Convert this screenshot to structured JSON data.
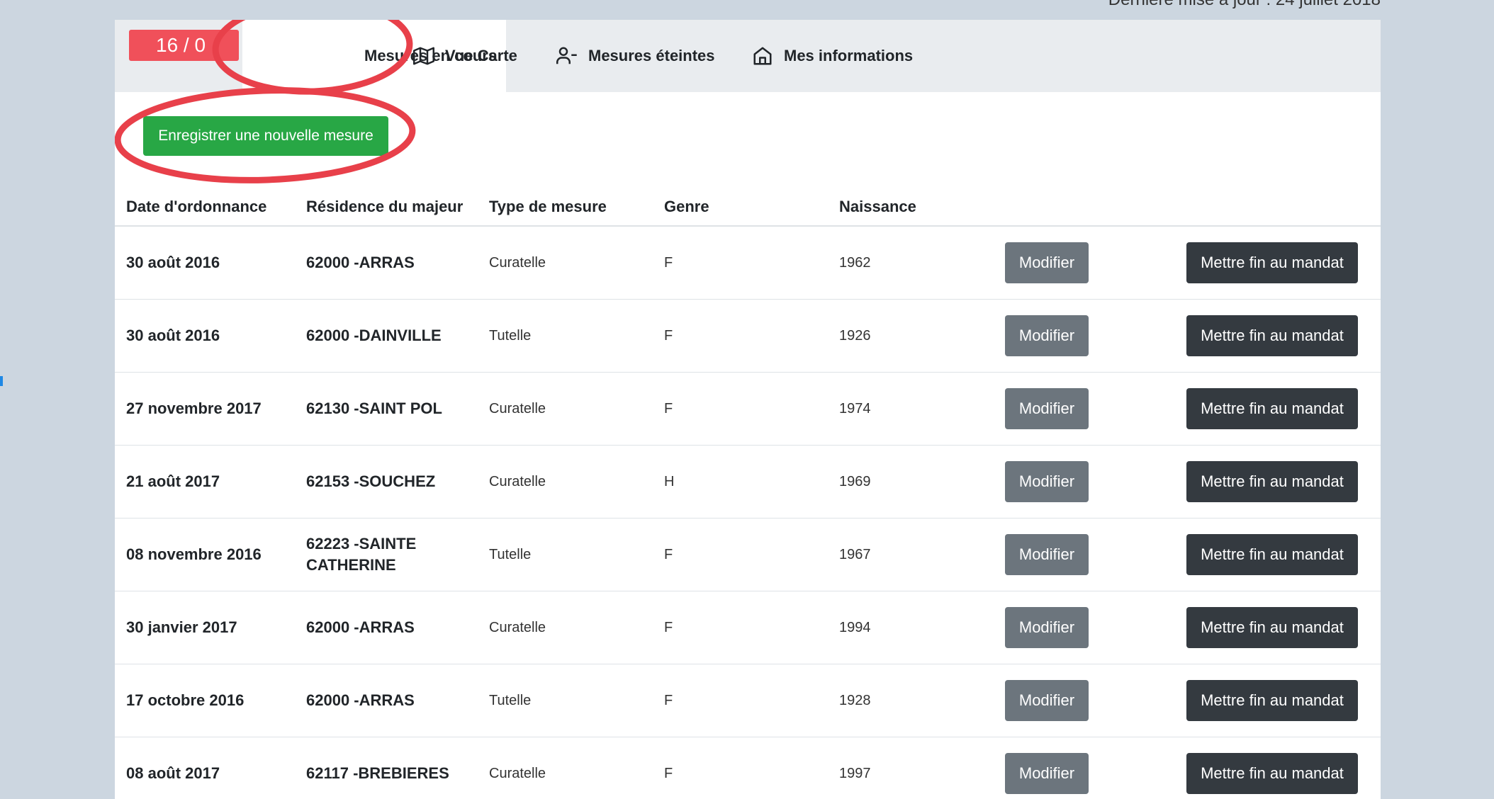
{
  "header": {
    "last_update": "Dernière mise à jour : 24 juillet 2018"
  },
  "counter": "16 / 0",
  "tabs": [
    {
      "label": "Mesures en cours",
      "icon": "none",
      "active": true
    },
    {
      "label": "Vue Carte",
      "icon": "map-icon"
    },
    {
      "label": "Mesures éteintes",
      "icon": "user-minus-icon"
    },
    {
      "label": "Mes informations",
      "icon": "home-icon"
    }
  ],
  "new_measure_button": "Enregistrer une nouvelle mesure",
  "table": {
    "columns": [
      "Date d'ordonnance",
      "Résidence du majeur",
      "Type de mesure",
      "Genre",
      "Naissance"
    ],
    "modify_label": "Modifier",
    "end_label": "Mettre fin au mandat",
    "rows": [
      {
        "date": "30 août 2016",
        "residence": "62000 -ARRAS",
        "type": "Curatelle",
        "genre": "F",
        "naissance": "1962"
      },
      {
        "date": "30 août 2016",
        "residence": "62000 -DAINVILLE",
        "type": "Tutelle",
        "genre": "F",
        "naissance": "1926"
      },
      {
        "date": "27 novembre 2017",
        "residence": "62130 -SAINT POL",
        "type": "Curatelle",
        "genre": "F",
        "naissance": "1974"
      },
      {
        "date": "21 août 2017",
        "residence": "62153 -SOUCHEZ",
        "type": "Curatelle",
        "genre": "H",
        "naissance": "1969"
      },
      {
        "date": "08 novembre 2016",
        "residence": "62223 -SAINTE CATHERINE",
        "type": "Tutelle",
        "genre": "F",
        "naissance": "1967"
      },
      {
        "date": "30 janvier 2017",
        "residence": "62000 -ARRAS",
        "type": "Curatelle",
        "genre": "F",
        "naissance": "1994"
      },
      {
        "date": "17 octobre 2016",
        "residence": "62000 -ARRAS",
        "type": "Tutelle",
        "genre": "F",
        "naissance": "1928"
      },
      {
        "date": "08 août 2017",
        "residence": "62117 -BREBIERES",
        "type": "Curatelle",
        "genre": "F",
        "naissance": "1997"
      }
    ]
  },
  "colors": {
    "background": "#ccd6e0",
    "badge": "#f0505a",
    "primary_green": "#28a745",
    "modify_gray": "#6c757d",
    "dark": "#343a40",
    "annotation_red": "#e8404a"
  }
}
